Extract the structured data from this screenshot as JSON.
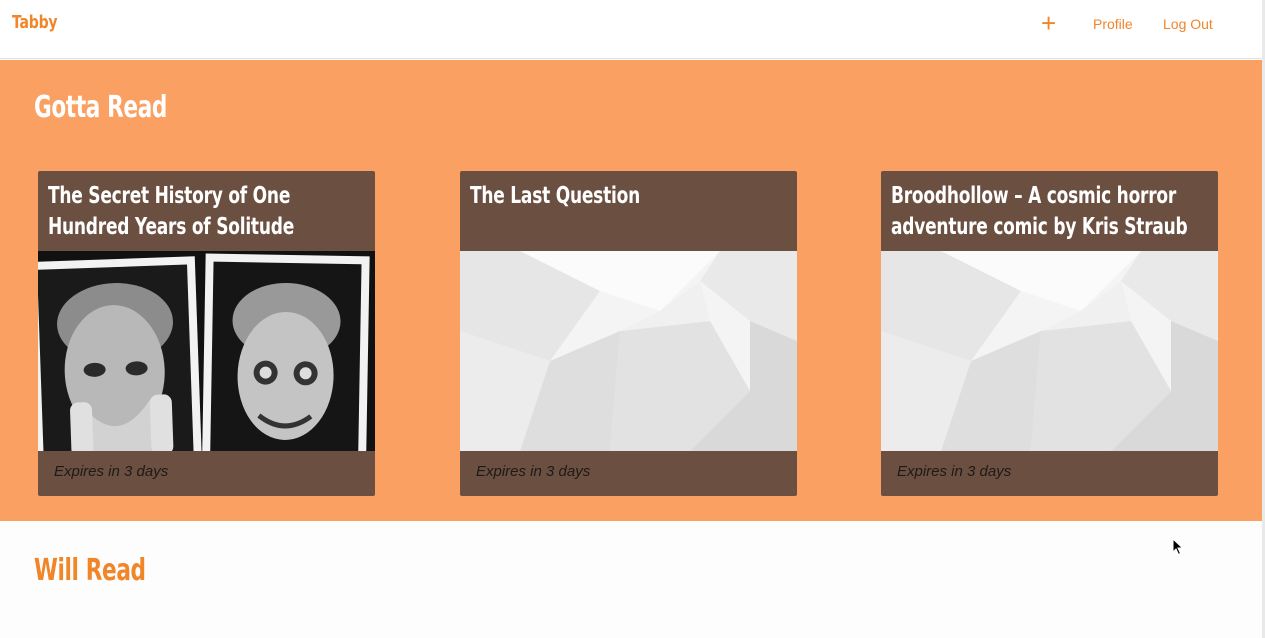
{
  "nav": {
    "brand": "Tabby",
    "add_label": "+",
    "profile_label": "Profile",
    "logout_label": "Log Out"
  },
  "gotta_read": {
    "title": "Gotta Read",
    "cards": [
      {
        "title": "The Secret History of One Hundred Years of Solitude",
        "footer": "Expires in 3 days",
        "image": "author-portrait-photos"
      },
      {
        "title": "The Last Question",
        "footer": "Expires in 3 days",
        "image": "placeholder-polygons"
      },
      {
        "title": "Broodhollow – A cosmic horror adventure comic by Kris Straub",
        "footer": "Expires in 3 days",
        "image": "placeholder-polygons"
      }
    ]
  },
  "will_read": {
    "title": "Will Read"
  },
  "colors": {
    "accent": "#f0852a",
    "section_bg": "#f9a062",
    "card_bg": "#6b4f41"
  }
}
